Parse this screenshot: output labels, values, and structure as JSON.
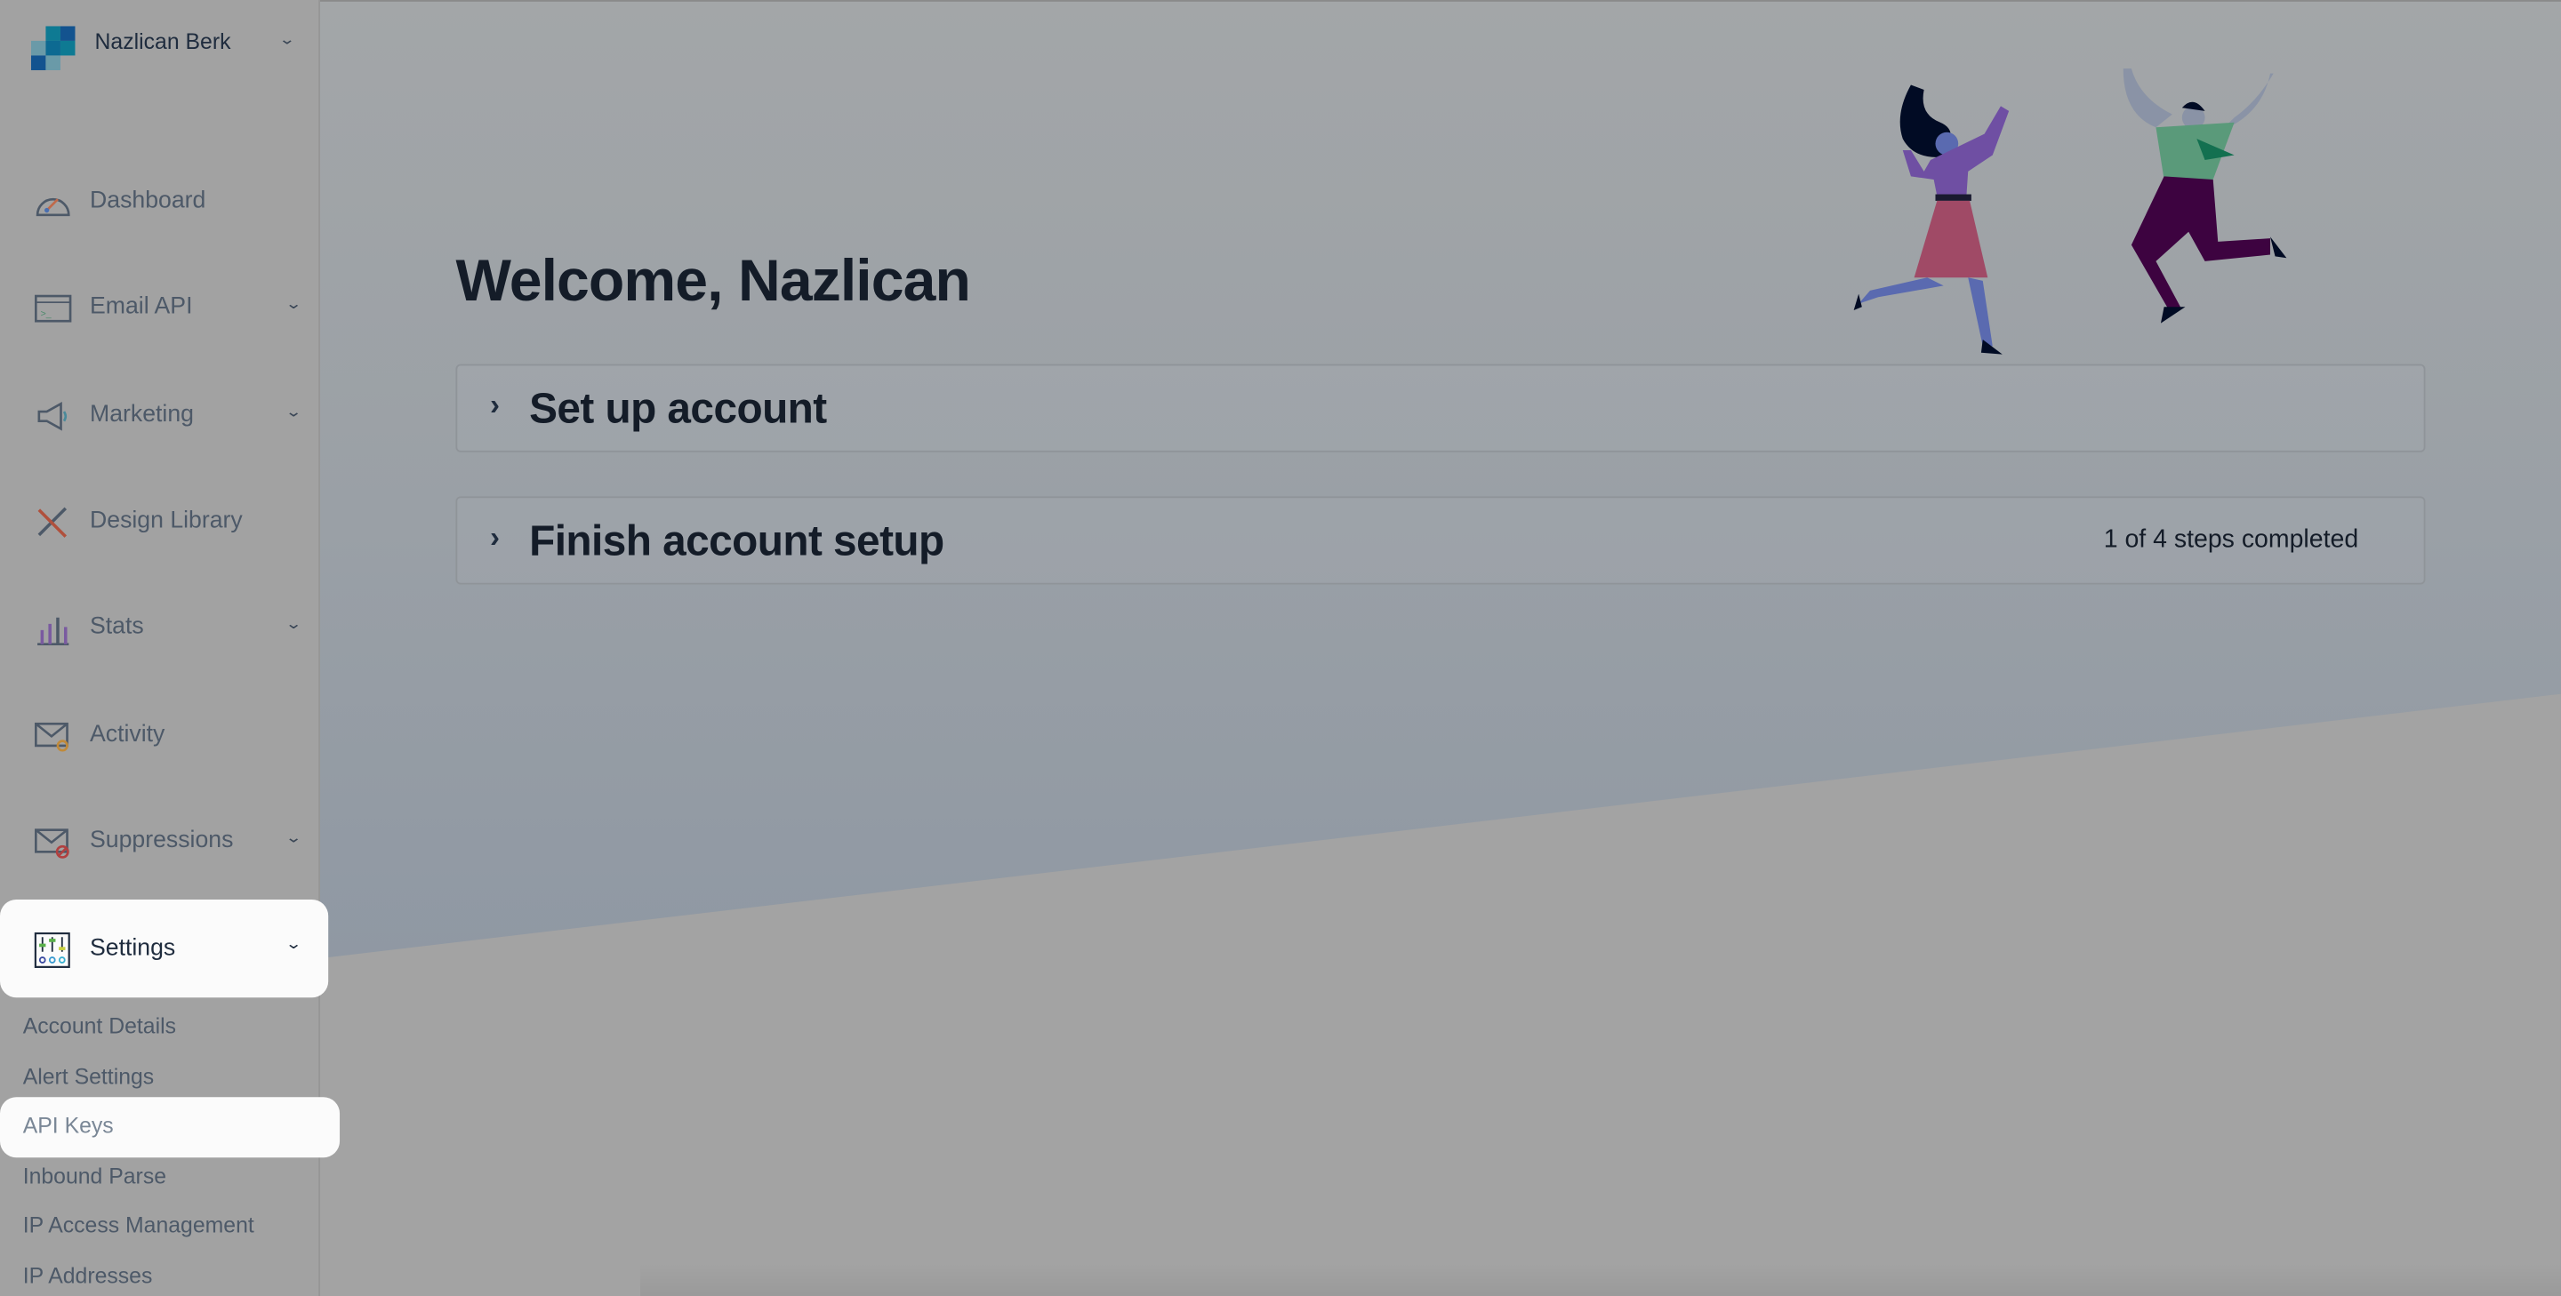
{
  "account": {
    "name": "Nazlican Berk"
  },
  "sidebar": {
    "items": [
      {
        "label": "Dashboard",
        "icon": "dashboard-gauge-icon",
        "expandable": false
      },
      {
        "label": "Email API",
        "icon": "email-api-icon",
        "expandable": true
      },
      {
        "label": "Marketing",
        "icon": "megaphone-icon",
        "expandable": true
      },
      {
        "label": "Design Library",
        "icon": "design-tools-icon",
        "expandable": false
      },
      {
        "label": "Stats",
        "icon": "stats-chart-icon",
        "expandable": true
      },
      {
        "label": "Activity",
        "icon": "activity-envelope-icon",
        "expandable": false
      },
      {
        "label": "Suppressions",
        "icon": "suppressions-envelope-icon",
        "expandable": true
      },
      {
        "label": "Settings",
        "icon": "settings-sliders-icon",
        "expandable": true,
        "expanded": true,
        "highlighted": true
      }
    ],
    "settings_subitems": [
      {
        "label": "Account Details"
      },
      {
        "label": "Alert Settings"
      },
      {
        "label": "API Keys",
        "highlighted": true
      },
      {
        "label": "Inbound Parse"
      },
      {
        "label": "IP Access Management"
      },
      {
        "label": "IP Addresses"
      }
    ]
  },
  "main": {
    "title": "Welcome, Nazlican",
    "sections": [
      {
        "label": "Set up account",
        "status": ""
      },
      {
        "label": "Finish account setup",
        "status": "1 of 4 steps completed"
      }
    ]
  },
  "colors": {
    "overlay": "#a2a2a2",
    "highlight": "#fbfbfb",
    "text_dark": "#141c28",
    "logo_blue": "#13538f",
    "logo_teal": "#0e7a93"
  }
}
